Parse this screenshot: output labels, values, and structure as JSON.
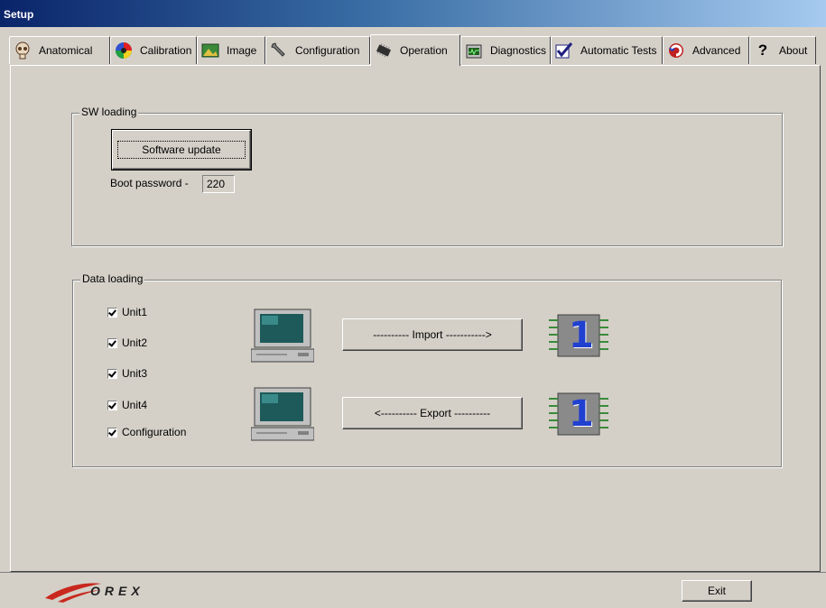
{
  "window": {
    "title": "Setup"
  },
  "tabs": [
    {
      "label": "Anatomical",
      "icon": "skull-icon"
    },
    {
      "label": "Calibration",
      "icon": "color-wheel-icon"
    },
    {
      "label": "Image",
      "icon": "image-icon"
    },
    {
      "label": "Configuration",
      "icon": "wrench-icon"
    },
    {
      "label": "Operation",
      "icon": "chip-icon",
      "active": true
    },
    {
      "label": "Diagnostics",
      "icon": "diagnostics-icon"
    },
    {
      "label": "Automatic Tests",
      "icon": "checkbox-icon"
    },
    {
      "label": "Advanced",
      "icon": "refresh-icon"
    },
    {
      "label": "About",
      "icon": "question-icon"
    }
  ],
  "sw_loading": {
    "title": "SW loading",
    "software_update_label": "Software update",
    "boot_password_label": "Boot password -",
    "boot_password_value": "220"
  },
  "data_loading": {
    "title": "Data loading",
    "checkboxes": [
      {
        "label": "Unit1",
        "checked": true
      },
      {
        "label": "Unit2",
        "checked": true
      },
      {
        "label": "Unit3",
        "checked": true
      },
      {
        "label": "Unit4",
        "checked": true
      },
      {
        "label": "Configuration",
        "checked": true
      }
    ],
    "import_label": "---------- Import ----------->",
    "export_label": "<---------- Export ----------",
    "memory_card_number": "1"
  },
  "footer": {
    "logo_text": "OREX",
    "exit_label": "Exit"
  },
  "colors": {
    "titlebar_start": "#0a246a",
    "titlebar_end": "#a6caf0",
    "face": "#d4d0c8",
    "logo_red": "#c8281e"
  }
}
